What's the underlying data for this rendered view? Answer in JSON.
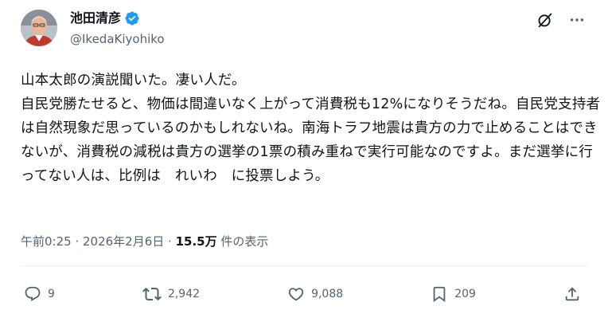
{
  "author": {
    "display_name": "池田清彦",
    "handle": "@IkedaKiyohiko",
    "verified_color": "#1d9bf0"
  },
  "tweet": {
    "text": "山本太郎の演説聞いた。凄い人だ。\n自民党勝たせると、物価は間違いなく上がって消費税も12%になりそうだね。自民党支持者は自然現象だ思っているのかもしれないね。南海トラフ地震は貴方の力で止めることはできないが、消費税の減税は貴方の選挙の1票の積み重ねで実行可能なのですよ。まだ選挙に行ってない人は、比例は　れいわ　に投票しよう。",
    "time": "午前0:25",
    "separator": " · ",
    "date": "2026年2月6日",
    "views_count": "15.5万",
    "views_label": " 件の表示"
  },
  "actions": {
    "replies": "9",
    "reposts": "2,942",
    "likes": "9,088",
    "bookmarks": "209"
  },
  "icons": {
    "grok": "slashed-circle-icon",
    "more": "more-horizontal-icon",
    "reply": "reply-icon",
    "repost": "repost-icon",
    "like": "heart-icon",
    "bookmark": "bookmark-icon",
    "share": "share-icon"
  }
}
